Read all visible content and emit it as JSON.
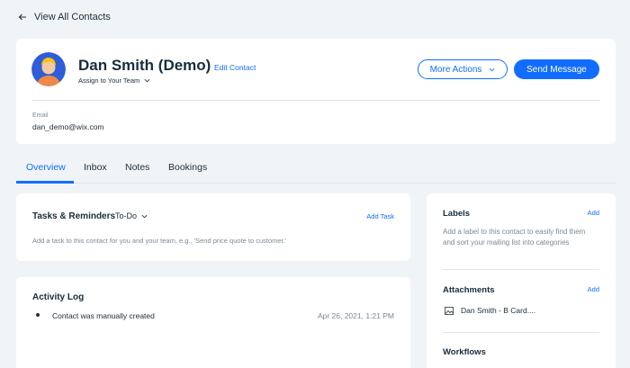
{
  "nav": {
    "back_label": "View All Contacts"
  },
  "contact": {
    "name": "Dan Smith (Demo)",
    "edit_label": "Edit Contact",
    "assign_label": "Assign to Your Team",
    "more_actions_label": "More Actions",
    "send_message_label": "Send Message",
    "email_label": "Email",
    "email_value": "dan_demo@wix.com"
  },
  "tabs": [
    {
      "label": "Overview",
      "active": true
    },
    {
      "label": "Inbox",
      "active": false
    },
    {
      "label": "Notes",
      "active": false
    },
    {
      "label": "Bookings",
      "active": false
    }
  ],
  "tasks": {
    "title": "Tasks & Reminders",
    "filter_label": "To-Do",
    "add_label": "Add Task",
    "description": "Add a task to this contact for you and your team, e.g., 'Send price quote to customer.'"
  },
  "activity": {
    "title": "Activity Log",
    "items": [
      {
        "text": "Contact was manually created",
        "date": "Apr 26, 2021, 1:21 PM"
      }
    ]
  },
  "sidebar": {
    "labels": {
      "title": "Labels",
      "add_label": "Add",
      "description": "Add a label to this contact to easily find them and sort your mailing list into categories"
    },
    "attachments": {
      "title": "Attachments",
      "add_label": "Add",
      "items": [
        {
          "name": "Dan Smith - B Card...."
        }
      ]
    },
    "workflows": {
      "title": "Workflows"
    }
  },
  "colors": {
    "accent": "#116dff",
    "background": "#f0f4f7",
    "avatar_bg": "#2f5dd8",
    "avatar_hair": "#f5c518"
  },
  "icons": [
    "arrow-left-icon",
    "chevron-down-icon",
    "image-file-icon",
    "avatar"
  ]
}
